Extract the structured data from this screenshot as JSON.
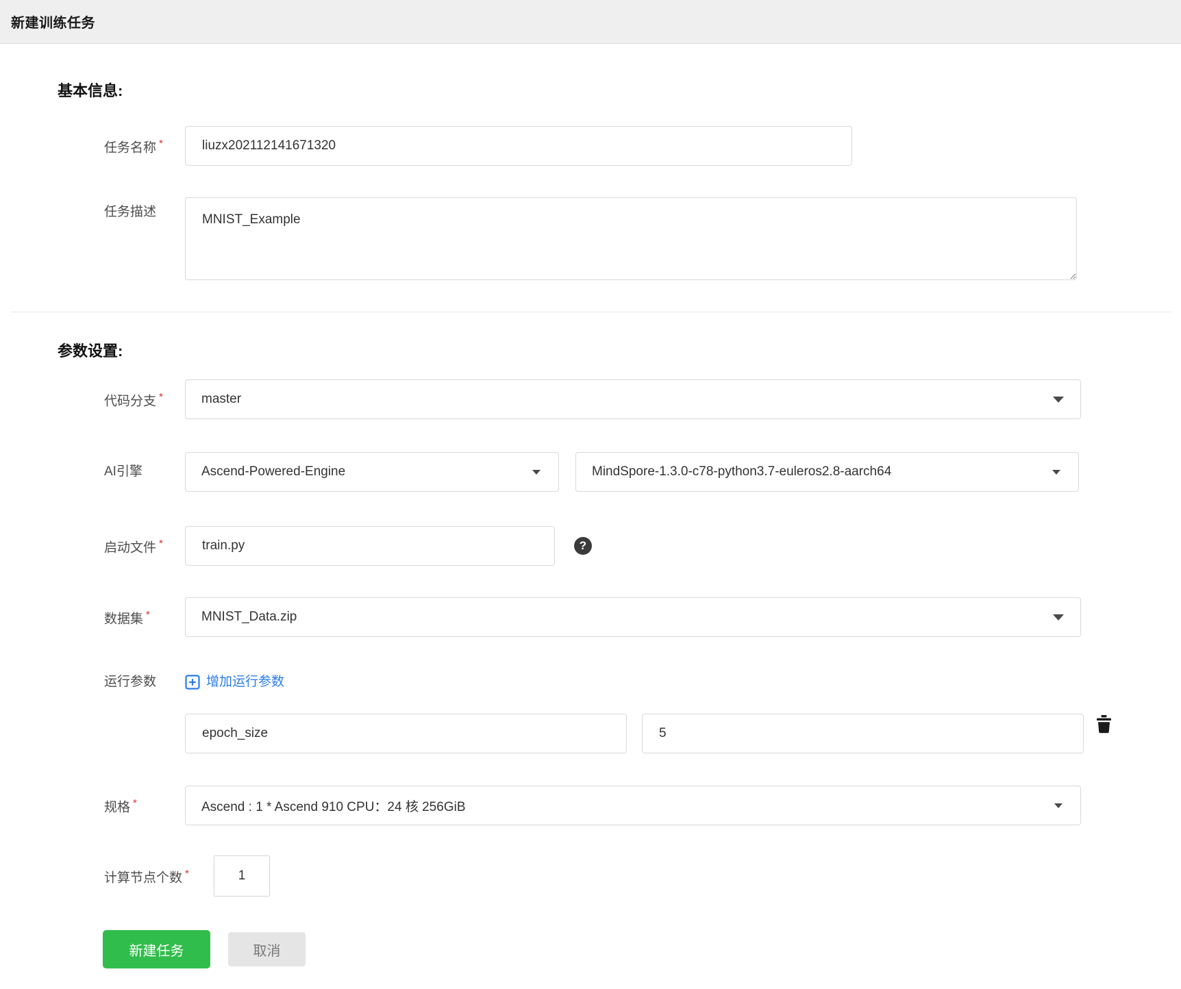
{
  "page": {
    "title": "新建训练任务"
  },
  "sections": {
    "basic": {
      "heading": "基本信息:"
    },
    "params": {
      "heading": "参数设置:"
    }
  },
  "fields": {
    "task_name": {
      "label": "任务名称",
      "required": "*",
      "value": "liuzx202112141671320"
    },
    "task_desc": {
      "label": "任务描述",
      "value": "MNIST_Example"
    },
    "code_branch": {
      "label": "代码分支",
      "required": "*",
      "value": "master"
    },
    "ai_engine": {
      "label": "AI引擎",
      "engine": "Ascend-Powered-Engine",
      "version": "MindSpore-1.3.0-c78-python3.7-euleros2.8-aarch64"
    },
    "boot_file": {
      "label": "启动文件",
      "required": "*",
      "value": "train.py",
      "help_icon": "question-circle"
    },
    "dataset": {
      "label": "数据集",
      "required": "*",
      "value": "MNIST_Data.zip"
    },
    "run_params": {
      "label": "运行参数",
      "add_link": "增加运行参数",
      "add_icon": "plus-square",
      "delete_icon": "trash",
      "rows": [
        {
          "key": "epoch_size",
          "value": "5"
        }
      ]
    },
    "spec": {
      "label": "规格",
      "required": "*",
      "value": "Ascend : 1 * Ascend 910 CPU：24 核 256GiB"
    },
    "node_count": {
      "label": "计算节点个数",
      "required": "*",
      "value": "1"
    }
  },
  "buttons": {
    "submit": "新建任务",
    "cancel": "取消"
  },
  "icons": {
    "dropdown": "caret-down"
  },
  "colors": {
    "primary_green": "#31bd4b",
    "link_blue": "#2b7ce9",
    "required_red": "#e02b2b",
    "titlebar_bg": "#efeff0"
  }
}
